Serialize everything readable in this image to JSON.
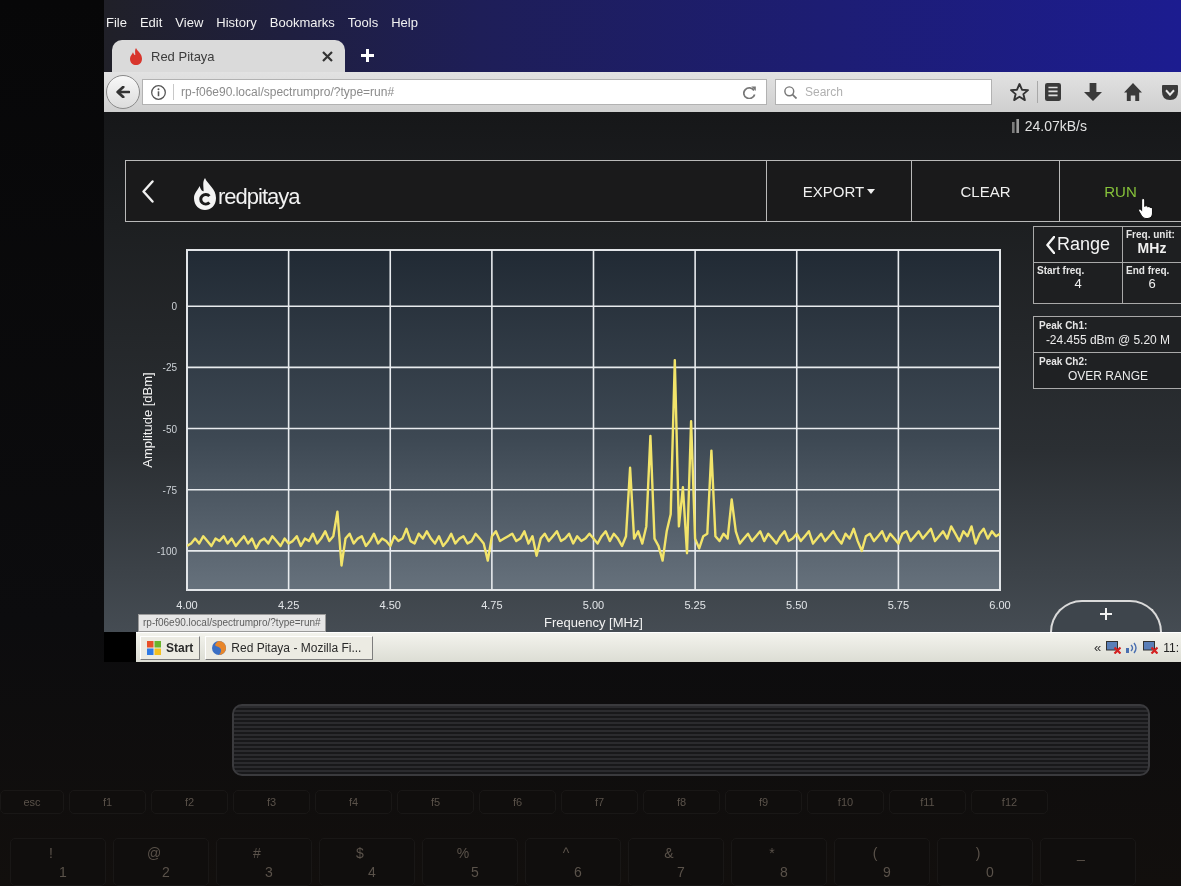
{
  "menu_bar": {
    "items": [
      {
        "label": "File"
      },
      {
        "label": "Edit"
      },
      {
        "label": "View"
      },
      {
        "label": "History"
      },
      {
        "label": "Bookmarks"
      },
      {
        "label": "Tools"
      },
      {
        "label": "Help"
      }
    ]
  },
  "tabs": [
    {
      "title": "Red Pitaya",
      "selected": true
    }
  ],
  "nav_bar": {
    "url": "rp-f06e90.local/spectrumpro/?type=run#",
    "search": {
      "placeholder": "Search"
    }
  },
  "app": {
    "transfer_rate": "24.07kB/s",
    "header": {
      "logo_text": "redpitaya",
      "buttons": [
        {
          "label": "EXPORT",
          "kind": "dropdown",
          "active": false
        },
        {
          "label": "CLEAR",
          "kind": "plain",
          "active": false
        },
        {
          "label": "RUN",
          "kind": "plain",
          "active": true
        }
      ]
    },
    "chart": {
      "chart_data": {
        "type": "line",
        "xlabel": "Frequency [MHz]",
        "ylabel": "Amplitude [dBm]",
        "x": [
          4,
          4.01,
          4.02,
          4.03,
          4.04,
          4.05,
          4.06,
          4.07,
          4.08,
          4.09,
          4.1,
          4.11,
          4.12,
          4.13,
          4.14,
          4.15,
          4.16,
          4.17,
          4.18,
          4.19,
          4.2,
          4.21,
          4.22,
          4.23,
          4.24,
          4.25,
          4.26,
          4.27,
          4.28,
          4.29,
          4.3,
          4.31,
          4.32,
          4.33,
          4.34,
          4.35,
          4.36,
          4.37,
          4.38,
          4.39,
          4.4,
          4.41,
          4.42,
          4.43,
          4.44,
          4.45,
          4.46,
          4.47,
          4.48,
          4.49,
          4.5,
          4.51,
          4.52,
          4.53,
          4.54,
          4.55,
          4.56,
          4.57,
          4.58,
          4.59,
          4.6,
          4.61,
          4.62,
          4.63,
          4.64,
          4.65,
          4.66,
          4.67,
          4.68,
          4.69,
          4.7,
          4.71,
          4.72,
          4.73,
          4.74,
          4.75,
          4.76,
          4.77,
          4.78,
          4.79,
          4.8,
          4.81,
          4.82,
          4.83,
          4.84,
          4.85,
          4.86,
          4.87,
          4.88,
          4.89,
          4.9,
          4.91,
          4.92,
          4.93,
          4.94,
          4.95,
          4.96,
          4.97,
          4.98,
          4.99,
          5,
          5.01,
          5.02,
          5.03,
          5.04,
          5.05,
          5.06,
          5.07,
          5.08,
          5.09,
          5.1,
          5.11,
          5.12,
          5.13,
          5.14,
          5.15,
          5.16,
          5.17,
          5.18,
          5.19,
          5.2,
          5.21,
          5.22,
          5.23,
          5.24,
          5.25,
          5.26,
          5.27,
          5.28,
          5.29,
          5.3,
          5.31,
          5.32,
          5.33,
          5.34,
          5.35,
          5.36,
          5.37,
          5.38,
          5.39,
          5.4,
          5.41,
          5.42,
          5.43,
          5.44,
          5.45,
          5.46,
          5.47,
          5.48,
          5.49,
          5.5,
          5.51,
          5.52,
          5.53,
          5.54,
          5.55,
          5.56,
          5.57,
          5.58,
          5.59,
          5.6,
          5.61,
          5.62,
          5.63,
          5.64,
          5.65,
          5.66,
          5.67,
          5.68,
          5.69,
          5.7,
          5.71,
          5.72,
          5.73,
          5.74,
          5.75,
          5.76,
          5.77,
          5.78,
          5.79,
          5.8,
          5.81,
          5.82,
          5.83,
          5.84,
          5.85,
          5.86,
          5.87,
          5.88,
          5.89,
          5.9,
          5.91,
          5.92,
          5.93,
          5.94,
          5.95,
          5.96,
          5.97,
          5.98,
          5.99,
          6
        ],
        "series": [
          {
            "color": "#f2e46a",
            "values": [
              -98,
              -97,
              -95,
              -97,
              -94,
              -96,
              -98,
              -95,
              -96,
              -94,
              -97,
              -95,
              -98,
              -96,
              -94,
              -97,
              -95,
              -99,
              -96,
              -95,
              -97,
              -94,
              -96,
              -98,
              -95,
              -97,
              -96,
              -94,
              -98,
              -95,
              -96,
              -93,
              -97,
              -95,
              -92,
              -96,
              -94,
              -84,
              -106,
              -95,
              -93,
              -97,
              -95,
              -94,
              -98,
              -96,
              -93,
              -97,
              -95,
              -96,
              -98,
              -94,
              -96,
              -95,
              -91,
              -96,
              -97,
              -93,
              -95,
              -92,
              -95,
              -97,
              -94,
              -98,
              -96,
              -93,
              -97,
              -95,
              -94,
              -97,
              -96,
              -93,
              -95,
              -97,
              -104,
              -94,
              -92,
              -96,
              -95,
              -94,
              -93,
              -96,
              -95,
              -92,
              -97,
              -94,
              -102,
              -95,
              -93,
              -96,
              -94,
              -92,
              -96,
              -95,
              -93,
              -97,
              -94,
              -96,
              -95,
              -93,
              -95,
              -97,
              -94,
              -92,
              -96,
              -93,
              -95,
              -98,
              -94,
              -66,
              -95,
              -92,
              -97,
              -90,
              -53,
              -95,
              -98,
              -104,
              -92,
              -85,
              -22,
              -90,
              -74,
              -101,
              -47,
              -95,
              -99,
              -94,
              -93,
              -59,
              -94,
              -96,
              -93,
              -95,
              -79,
              -92,
              -97,
              -95,
              -93,
              -96,
              -94,
              -92,
              -96,
              -93,
              -95,
              -97,
              -94,
              -92,
              -96,
              -95,
              -93,
              -96,
              -94,
              -92,
              -97,
              -95,
              -93,
              -96,
              -94,
              -92,
              -95,
              -97,
              -93,
              -95,
              -91,
              -96,
              -100,
              -94,
              -93,
              -96,
              -94,
              -92,
              -96,
              -93,
              -95,
              -97,
              -93,
              -92,
              -96,
              -94,
              -92,
              -95,
              -93,
              -91,
              -96,
              -94,
              -92,
              -95,
              -90,
              -93,
              -96,
              -92,
              -94,
              -90,
              -97,
              -93,
              -91,
              -95,
              -92,
              -94,
              -93
            ]
          }
        ],
        "xlim": [
          4,
          6
        ],
        "ylim": [
          -116,
          23
        ],
        "xticks": [
          {
            "value": 4,
            "label": "4.00"
          },
          {
            "value": 4.25,
            "label": "4.25"
          },
          {
            "value": 4.5,
            "label": "4.50"
          },
          {
            "value": 4.75,
            "label": "4.75"
          },
          {
            "value": 5,
            "label": "5.00"
          },
          {
            "value": 5.25,
            "label": "5.25"
          },
          {
            "value": 5.5,
            "label": "5.50"
          },
          {
            "value": 5.75,
            "label": "5.75"
          },
          {
            "value": 6,
            "label": "6.00"
          }
        ],
        "yticks": [
          0,
          -25,
          -50,
          -75,
          -100
        ],
        "grid": true
      }
    },
    "range_panel": {
      "back_label": "Range",
      "settings": [
        {
          "label": "Freq. unit:",
          "value": "MHz",
          "kind": "select"
        },
        {
          "label": "Start freq.",
          "value": "4",
          "kind": "number"
        },
        {
          "label": "End freq.",
          "value": "6",
          "kind": "number"
        }
      ]
    },
    "peaks": [
      {
        "label": "Peak Ch1:",
        "value": "-24.455 dBm @ 5.20 M"
      },
      {
        "label": "Peak Ch2:",
        "value": "OVER RANGE"
      }
    ]
  },
  "status_tooltip": "rp-f06e90.local/spectrumpro/?type=run#",
  "taskbar": {
    "start_label": "Start",
    "tasks": [
      {
        "label": "Red Pitaya - Mozilla Fi...",
        "selected": false
      }
    ],
    "tray_toggle": "«",
    "clock": "11:"
  },
  "keyboard": {
    "function_keys": [
      "esc",
      "f1",
      "f2",
      "f3",
      "f4",
      "f5",
      "f6",
      "f7",
      "f8",
      "f9",
      "f10",
      "f11",
      "f12"
    ],
    "number_keys": [
      {
        "shifted": "!",
        "base": "1"
      },
      {
        "shifted": "@",
        "base": "2"
      },
      {
        "shifted": "#",
        "base": "3"
      },
      {
        "shifted": "$",
        "base": "4"
      },
      {
        "shifted": "%",
        "base": "5"
      },
      {
        "shifted": "^",
        "base": "6"
      },
      {
        "shifted": "&",
        "base": "7"
      },
      {
        "shifted": "*",
        "base": "8"
      },
      {
        "shifted": "(",
        "base": "9"
      },
      {
        "shifted": ")",
        "base": "0"
      },
      {
        "shifted": "_"
      }
    ]
  }
}
